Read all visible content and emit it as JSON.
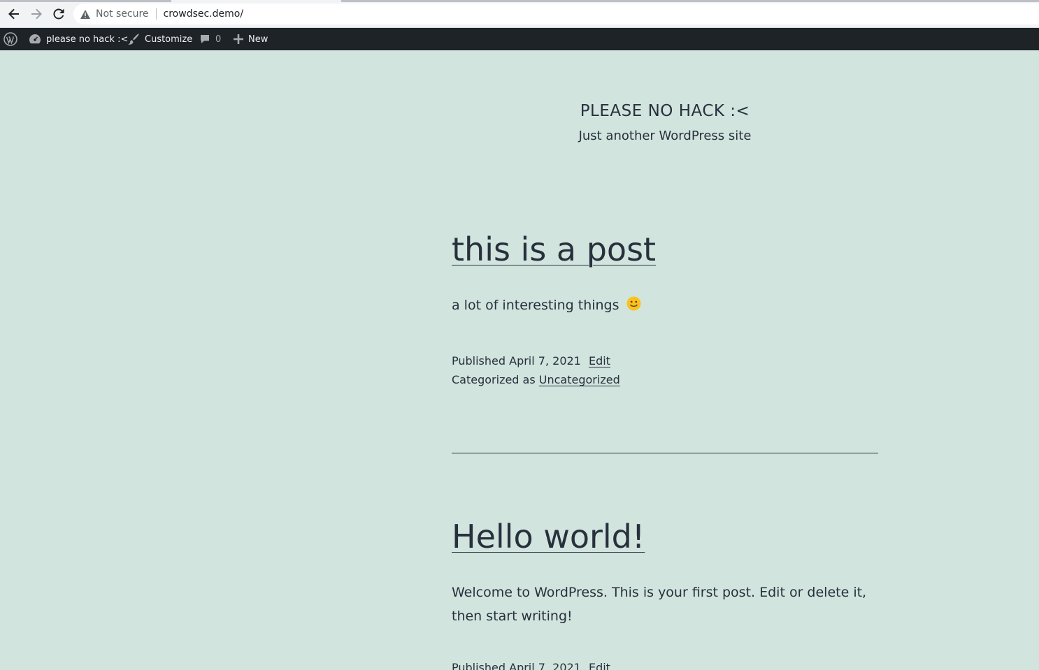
{
  "browser": {
    "security_label": "Not secure",
    "url": "crowdsec.demo/"
  },
  "admin_bar": {
    "site_name": "please no hack :<",
    "customize_label": "Customize",
    "comments_count": "0",
    "new_label": "New"
  },
  "site": {
    "title": "PLEASE NO HACK :<",
    "description": "Just another WordPress site"
  },
  "posts": [
    {
      "title": "this is a post",
      "excerpt": "a lot of interesting things",
      "published_prefix": "Published",
      "published_date": "April 7, 2021",
      "edit_label": "Edit",
      "categorized_prefix": "Categorized as",
      "category": "Uncategorized"
    },
    {
      "title": "Hello world!",
      "excerpt": "Welcome to WordPress. This is your first post. Edit or delete it, then start writing!",
      "published_prefix": "Published",
      "published_date": "April 7, 2021",
      "edit_label": "Edit"
    }
  ],
  "colors": {
    "background": "#d1e4dd",
    "text": "#28303d",
    "admin_bar": "#1d2327"
  }
}
